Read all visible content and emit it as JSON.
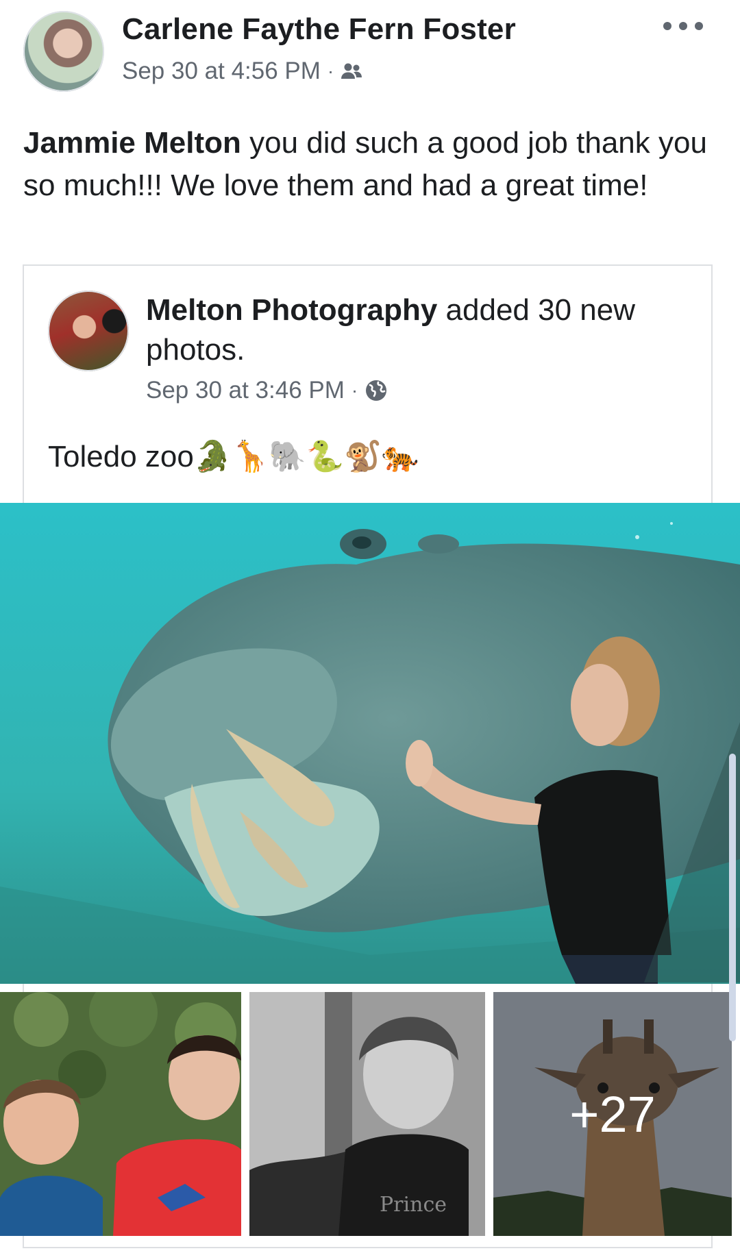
{
  "post": {
    "author": "Carlene Faythe Fern Foster",
    "timestamp": "Sep 30 at 4:56 PM",
    "separator": "·",
    "audience_icon": "friends-icon",
    "mentioned_name": "Jammie Melton",
    "body": " you did such a good job thank you so much!!! We love them and had a great time!"
  },
  "shared": {
    "page_name": "Melton Photography",
    "action": " added 30 new photos.",
    "timestamp": "Sep 30 at 3:46 PM",
    "separator": "·",
    "audience_icon": "globe-icon",
    "caption": "Toledo zoo🐊🦒🐘🐍🐒🐅"
  },
  "photos": {
    "main": "hippo-and-child",
    "thumbs": [
      "two-boys",
      "girl-bw-portrait",
      "giraffe"
    ],
    "more_count": "+27"
  },
  "colors": {
    "text": "#1c1e21",
    "meta": "#606770",
    "border": "#dddfe2"
  }
}
